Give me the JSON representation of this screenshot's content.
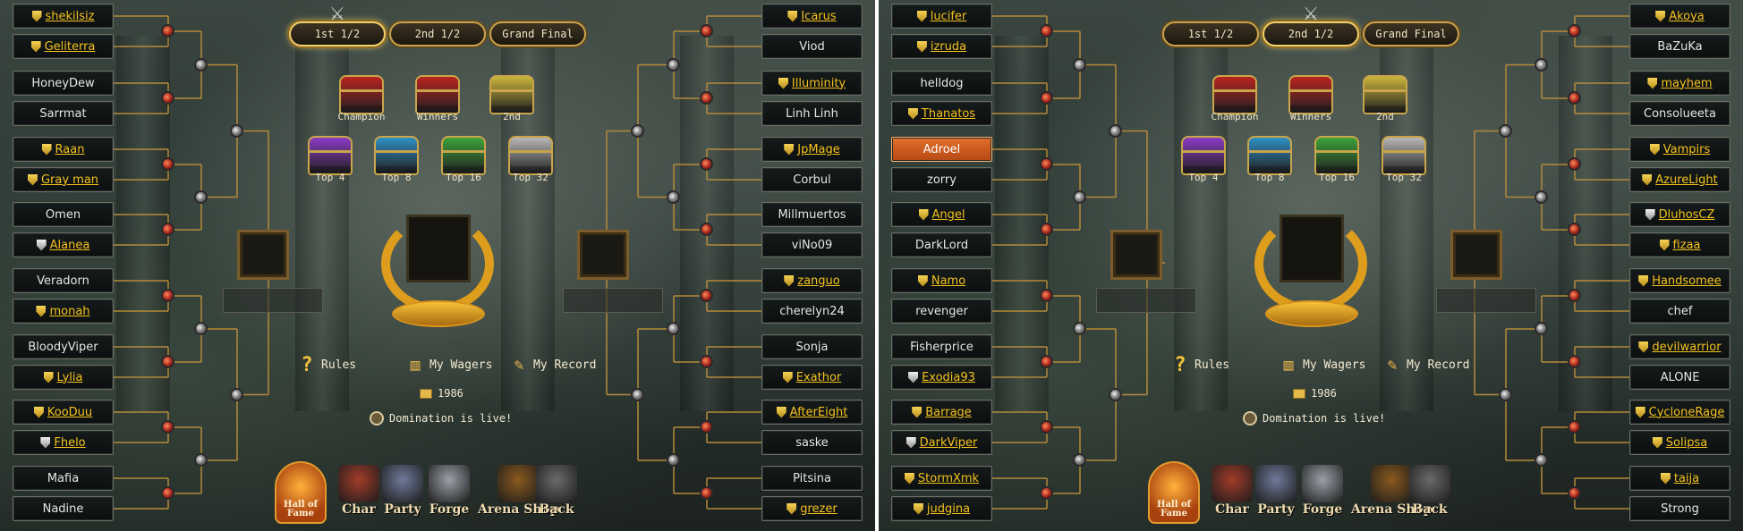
{
  "panels": [
    {
      "tabs": [
        "1st 1/2",
        "2nd 1/2",
        "Grand Final"
      ],
      "active_tab": 0,
      "left_players": [
        {
          "name": "shekilsiz",
          "style": "gold",
          "shield": "gold"
        },
        {
          "name": "Geliterra",
          "style": "gold",
          "shield": "gold"
        },
        {
          "name": "HoneyDew",
          "style": "plain",
          "shield": ""
        },
        {
          "name": "Sarrmat",
          "style": "plain",
          "shield": ""
        },
        {
          "name": "Raan",
          "style": "gold",
          "shield": "gold"
        },
        {
          "name": "Gray man",
          "style": "gold",
          "shield": "gold"
        },
        {
          "name": "Omen",
          "style": "plain",
          "shield": ""
        },
        {
          "name": "Alanea",
          "style": "gold",
          "shield": "silver"
        },
        {
          "name": "Veradorn",
          "style": "plain",
          "shield": ""
        },
        {
          "name": "monah",
          "style": "gold",
          "shield": "gold"
        },
        {
          "name": "BloodyViper",
          "style": "plain",
          "shield": ""
        },
        {
          "name": "Lylia",
          "style": "gold",
          "shield": "gold"
        },
        {
          "name": "KooDuu",
          "style": "gold",
          "shield": "gold"
        },
        {
          "name": "Fhelo",
          "style": "gold",
          "shield": "silver"
        },
        {
          "name": "Mafia",
          "style": "plain",
          "shield": ""
        },
        {
          "name": "Nadine",
          "style": "plain",
          "shield": ""
        }
      ],
      "right_players": [
        {
          "name": "Icarus",
          "style": "gold",
          "shield": "gold"
        },
        {
          "name": "Viod",
          "style": "plain",
          "shield": ""
        },
        {
          "name": "Illuminity",
          "style": "gold",
          "shield": "gold"
        },
        {
          "name": "Linh Linh",
          "style": "plain",
          "shield": ""
        },
        {
          "name": "JpMage",
          "style": "gold",
          "shield": "gold"
        },
        {
          "name": "Corbul",
          "style": "plain",
          "shield": ""
        },
        {
          "name": "Millmuertos",
          "style": "plain",
          "shield": ""
        },
        {
          "name": "viNo09",
          "style": "plain",
          "shield": ""
        },
        {
          "name": "zanguo",
          "style": "gold",
          "shield": "gold"
        },
        {
          "name": "cherelyn24",
          "style": "plain",
          "shield": ""
        },
        {
          "name": "Sonja",
          "style": "plain",
          "shield": ""
        },
        {
          "name": "Exathor",
          "style": "gold",
          "shield": "gold"
        },
        {
          "name": "AfterEight",
          "style": "gold",
          "shield": "gold"
        },
        {
          "name": "saske",
          "style": "plain",
          "shield": ""
        },
        {
          "name": "Pitsina",
          "style": "plain",
          "shield": ""
        },
        {
          "name": "grezer",
          "style": "gold",
          "shield": "gold"
        }
      ]
    },
    {
      "tabs": [
        "1st 1/2",
        "2nd 1/2",
        "Grand Final"
      ],
      "active_tab": 1,
      "left_players": [
        {
          "name": "lucifer",
          "style": "gold",
          "shield": "gold"
        },
        {
          "name": "izruda",
          "style": "gold",
          "shield": "gold"
        },
        {
          "name": "helldog",
          "style": "plain",
          "shield": ""
        },
        {
          "name": "Thanatos",
          "style": "gold",
          "shield": "gold"
        },
        {
          "name": "Adroel",
          "style": "selected",
          "shield": ""
        },
        {
          "name": "zorry",
          "style": "plain",
          "shield": ""
        },
        {
          "name": "Angel",
          "style": "gold",
          "shield": "gold"
        },
        {
          "name": "DarkLord",
          "style": "plain",
          "shield": ""
        },
        {
          "name": "Namo",
          "style": "gold",
          "shield": "gold"
        },
        {
          "name": "revenger",
          "style": "plain",
          "shield": ""
        },
        {
          "name": "Fisherprice",
          "style": "plain",
          "shield": ""
        },
        {
          "name": "Exodia93",
          "style": "gold",
          "shield": "silver"
        },
        {
          "name": "Barrage",
          "style": "gold",
          "shield": "gold"
        },
        {
          "name": "DarkViper",
          "style": "gold",
          "shield": "silver"
        },
        {
          "name": "StormXmk",
          "style": "gold",
          "shield": "gold"
        },
        {
          "name": "judgina",
          "style": "gold",
          "shield": "gold"
        }
      ],
      "right_players": [
        {
          "name": "Akoya",
          "style": "gold",
          "shield": "gold"
        },
        {
          "name": "BaZuKa",
          "style": "plain",
          "shield": ""
        },
        {
          "name": "mayhem",
          "style": "gold",
          "shield": "gold"
        },
        {
          "name": "Consolueeta",
          "style": "plain",
          "shield": ""
        },
        {
          "name": "Vampirs",
          "style": "gold",
          "shield": "gold"
        },
        {
          "name": "AzureLight",
          "style": "gold",
          "shield": "gold"
        },
        {
          "name": "DluhosCZ",
          "style": "gold",
          "shield": "silver"
        },
        {
          "name": "fizaa",
          "style": "gold",
          "shield": "gold"
        },
        {
          "name": "Handsomee",
          "style": "gold",
          "shield": "gold"
        },
        {
          "name": "chef",
          "style": "plain",
          "shield": ""
        },
        {
          "name": "devilwarrior",
          "style": "gold",
          "shield": "gold"
        },
        {
          "name": "ALONE",
          "style": "plain",
          "shield": ""
        },
        {
          "name": "CycloneRage",
          "style": "gold",
          "shield": "gold"
        },
        {
          "name": "Solipsa",
          "style": "gold",
          "shield": "gold"
        },
        {
          "name": "taija",
          "style": "gold",
          "shield": "gold"
        },
        {
          "name": "Strong",
          "style": "plain",
          "shield": ""
        }
      ]
    }
  ],
  "rewards": [
    {
      "label": "Champion",
      "color": "#b8231f"
    },
    {
      "label": "Winners",
      "color": "#b8231f"
    },
    {
      "label": "2nd",
      "color": "#c9b43a"
    },
    {
      "label": "Top 4",
      "color": "#8a3bc4"
    },
    {
      "label": "Top 8",
      "color": "#2d8fc4"
    },
    {
      "label": "Top 16",
      "color": "#3ca23a"
    },
    {
      "label": "Top 32",
      "color": "#b7b7b7"
    }
  ],
  "links": {
    "rules": "Rules",
    "wagers": "My Wagers",
    "record": "My Record"
  },
  "coins": "1986",
  "status": "Domination is live!",
  "nav": [
    {
      "label": "Hall of Fame",
      "icon": "hall-of-fame-icon"
    },
    {
      "label": "Char",
      "icon": "character-icon"
    },
    {
      "label": "Party",
      "icon": "party-icon"
    },
    {
      "label": "Forge",
      "icon": "forge-icon"
    },
    {
      "label": "Arena Shop",
      "icon": "arena-shop-icon"
    },
    {
      "label": "Back",
      "icon": "back-arrow-icon"
    }
  ],
  "colors": {
    "gold_text": "#f4c21e",
    "selected_bg": "#d55f22",
    "tab_border": "#caa24a"
  }
}
